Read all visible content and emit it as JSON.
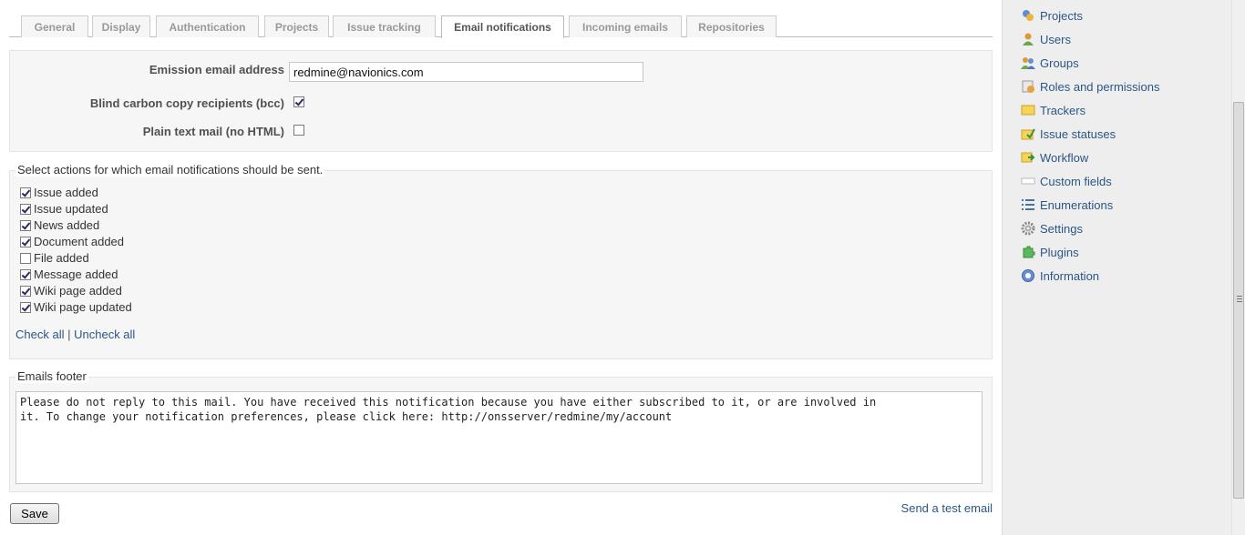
{
  "tabs": [
    {
      "label": "General"
    },
    {
      "label": "Display"
    },
    {
      "label": "Authentication"
    },
    {
      "label": "Projects"
    },
    {
      "label": "Issue tracking"
    },
    {
      "label": "Email notifications"
    },
    {
      "label": "Incoming emails"
    },
    {
      "label": "Repositories"
    }
  ],
  "settings": {
    "emission_label": "Emission email address",
    "emission_value": "redmine@navionics.com",
    "bcc_label": "Blind carbon copy recipients (bcc)",
    "bcc_checked": true,
    "plain_label": "Plain text mail (no HTML)",
    "plain_checked": false
  },
  "notifications": {
    "legend": "Select actions for which email notifications should be sent.",
    "items": [
      {
        "label": "Issue added",
        "checked": true
      },
      {
        "label": "Issue updated",
        "checked": true
      },
      {
        "label": "News added",
        "checked": true
      },
      {
        "label": "Document added",
        "checked": true
      },
      {
        "label": "File added",
        "checked": false
      },
      {
        "label": "Message added",
        "checked": true
      },
      {
        "label": "Wiki page added",
        "checked": true
      },
      {
        "label": "Wiki page updated",
        "checked": true
      }
    ],
    "check_all": "Check all",
    "separator": "|",
    "uncheck_all": "Uncheck all"
  },
  "footer": {
    "legend": "Emails footer",
    "text": "Please do not reply to this mail. You have received this notification because you have either subscribed to it, or are involved in\nit. To change your notification preferences, please click here: http://onsserver/redmine/my/account"
  },
  "actions": {
    "save": "Save",
    "test_email": "Send a test email"
  },
  "sidebar": {
    "items": [
      {
        "label": "Projects",
        "icon": "projects-icon"
      },
      {
        "label": "Users",
        "icon": "user-icon"
      },
      {
        "label": "Groups",
        "icon": "group-icon"
      },
      {
        "label": "Roles and permissions",
        "icon": "roles-icon"
      },
      {
        "label": "Trackers",
        "icon": "tracker-icon"
      },
      {
        "label": "Issue statuses",
        "icon": "issue-status-icon"
      },
      {
        "label": "Workflow",
        "icon": "workflow-icon"
      },
      {
        "label": "Custom fields",
        "icon": "custom-fields-icon"
      },
      {
        "label": "Enumerations",
        "icon": "list-icon"
      },
      {
        "label": "Settings",
        "icon": "gear-icon"
      },
      {
        "label": "Plugins",
        "icon": "plugin-icon"
      },
      {
        "label": "Information",
        "icon": "info-icon"
      }
    ]
  },
  "colors": {
    "link": "#2a5685",
    "tab_text": "#999999",
    "sidebar_bg": "#eeeeee"
  }
}
